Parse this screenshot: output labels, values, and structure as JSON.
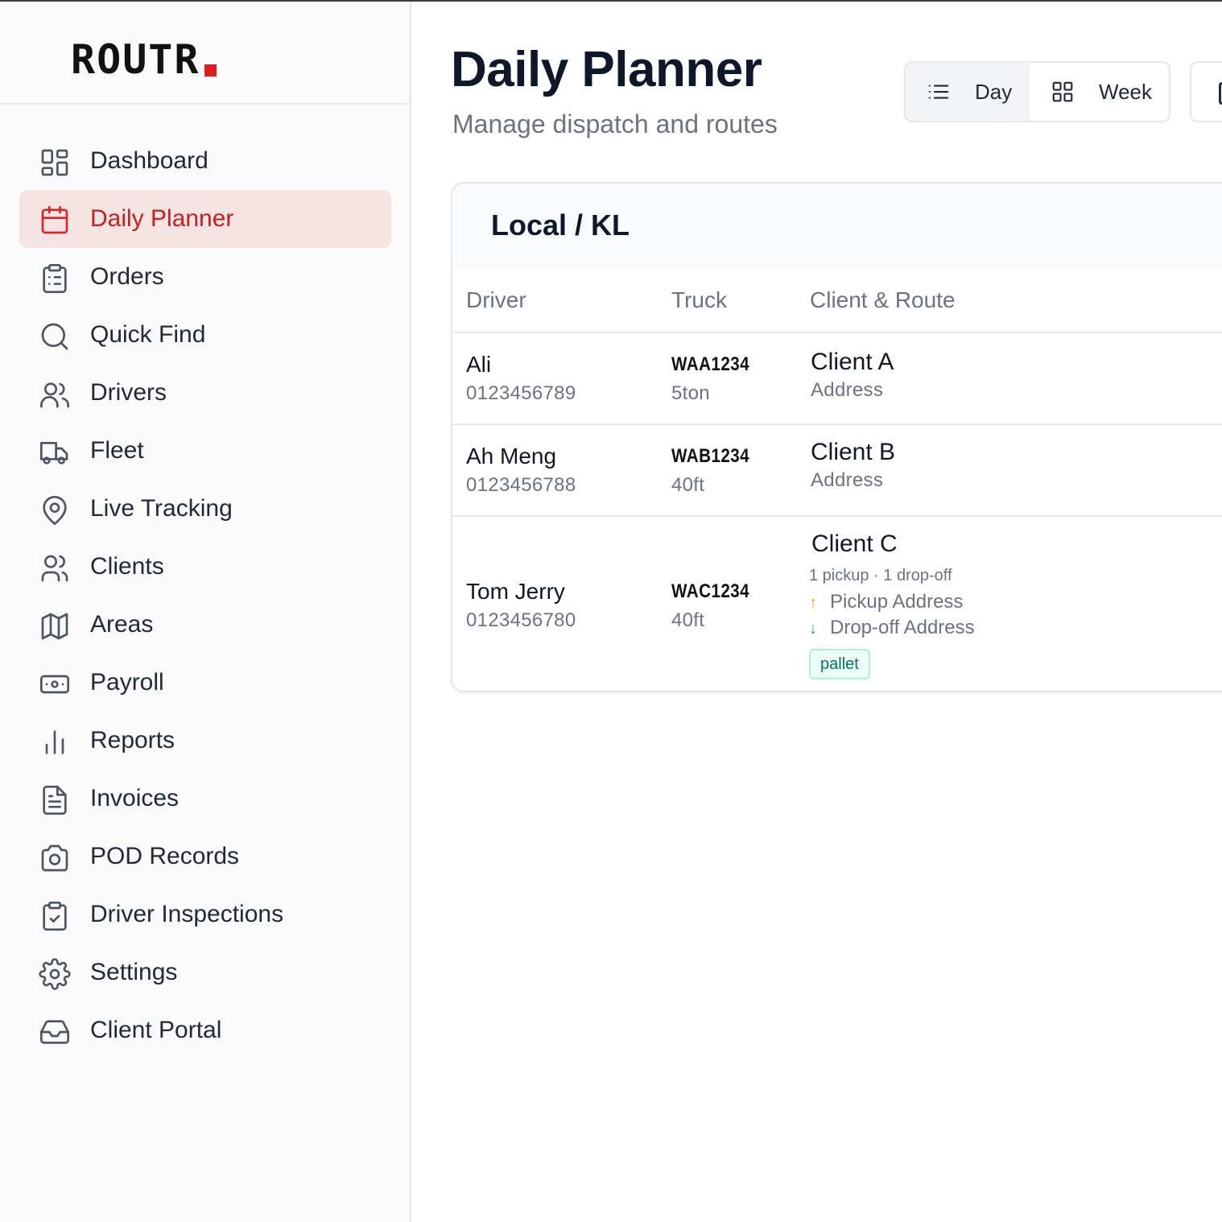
{
  "app": {
    "brand": "ROUTR",
    "brand_dot_color": "#e11d1d",
    "accent_color": "#c81e1e"
  },
  "sidebar": {
    "items": [
      {
        "label": "Dashboard",
        "icon": "dashboard-grid-icon",
        "active": false
      },
      {
        "label": "Daily Planner",
        "icon": "calendar-icon",
        "active": true
      },
      {
        "label": "Orders",
        "icon": "clipboard-list-icon",
        "active": false
      },
      {
        "label": "Quick Find",
        "icon": "search-icon",
        "active": false
      },
      {
        "label": "Drivers",
        "icon": "users-icon",
        "active": false
      },
      {
        "label": "Fleet",
        "icon": "truck-icon",
        "active": false
      },
      {
        "label": "Live Tracking",
        "icon": "map-pin-icon",
        "active": false
      },
      {
        "label": "Clients",
        "icon": "user-group-icon",
        "active": false
      },
      {
        "label": "Areas",
        "icon": "map-icon",
        "active": false
      },
      {
        "label": "Payroll",
        "icon": "banknote-icon",
        "active": false
      },
      {
        "label": "Reports",
        "icon": "bar-chart-icon",
        "active": false
      },
      {
        "label": "Invoices",
        "icon": "file-text-icon",
        "active": false
      },
      {
        "label": "POD Records",
        "icon": "camera-icon",
        "active": false
      },
      {
        "label": "Driver Inspections",
        "icon": "clipboard-check-icon",
        "active": false
      },
      {
        "label": "Settings",
        "icon": "gear-icon",
        "active": false
      },
      {
        "label": "Client Portal",
        "icon": "inbox-icon",
        "active": false
      }
    ]
  },
  "header": {
    "title": "Daily Planner",
    "subtitle": "Manage dispatch and routes",
    "view_toggle": {
      "day_label": "Day",
      "week_label": "Week",
      "selected": "Day"
    }
  },
  "card": {
    "title": "Local / KL",
    "columns": [
      "Driver",
      "Truck",
      "Client & Route"
    ],
    "rows": [
      {
        "driver_name": "Ali",
        "driver_phone": "0123456789",
        "truck_plate": "WAA1234",
        "truck_type": "5ton",
        "client": "Client A",
        "address": "Address"
      },
      {
        "driver_name": "Ah Meng",
        "driver_phone": "0123456788",
        "truck_plate": "WAB1234",
        "truck_type": "40ft",
        "client": "Client B",
        "address": "Address"
      },
      {
        "driver_name": "Tom Jerry",
        "driver_phone": "0123456780",
        "truck_plate": "WAC1234",
        "truck_type": "40ft",
        "client": "Client C",
        "stops_summary": "1 pickup · 1 drop-off",
        "pickup_arrow": "↑",
        "pickup_address": "Pickup Address",
        "dropoff_arrow": "↓",
        "dropoff_address": "Drop-off Address",
        "tag": "pallet"
      }
    ]
  }
}
